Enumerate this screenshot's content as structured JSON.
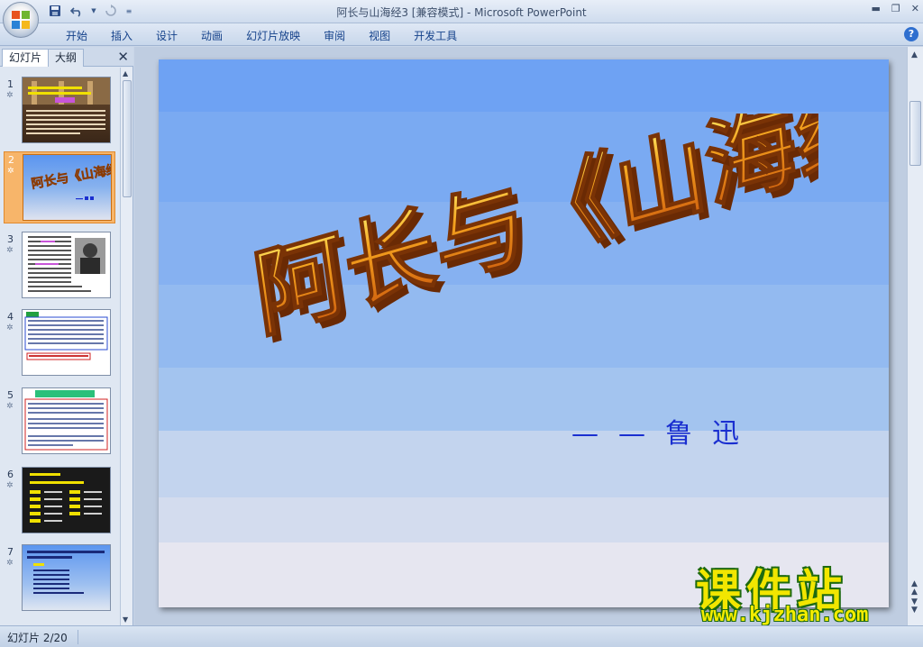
{
  "window": {
    "title": "阿长与山海经3 [兼容模式]",
    "separator": " - ",
    "app_name": "Microsoft PowerPoint"
  },
  "quick_access": {
    "items": [
      "save-icon",
      "undo-icon",
      "redo-icon",
      "customize-icon"
    ]
  },
  "ribbon": {
    "tabs": [
      "开始",
      "插入",
      "设计",
      "动画",
      "幻灯片放映",
      "审阅",
      "视图",
      "开发工具"
    ],
    "help": "?"
  },
  "left_pane": {
    "tab_slides": "幻灯片",
    "tab_outline": "大纲",
    "close": "✕",
    "selected_slide": 2,
    "thumbnails": [
      {
        "number": "1",
        "star": "✲"
      },
      {
        "number": "2",
        "star": "✲"
      },
      {
        "number": "3",
        "star": "✲"
      },
      {
        "number": "4",
        "star": "✲"
      },
      {
        "number": "5",
        "star": "✲"
      },
      {
        "number": "6",
        "star": "✲"
      },
      {
        "number": "7",
        "star": "✲"
      }
    ]
  },
  "slide": {
    "title": "阿长与《山海经》",
    "author": "——鲁迅",
    "title_color": "#e8861c",
    "author_color": "#1a2fd0"
  },
  "watermark": {
    "main": "课件站",
    "url": "www.kjzhan.com"
  },
  "status": {
    "slide_indicator": "幻灯片 2/20"
  }
}
